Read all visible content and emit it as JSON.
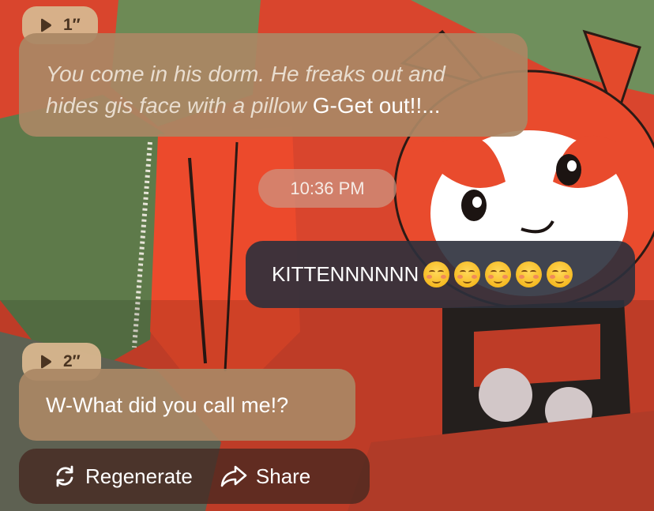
{
  "messages": [
    {
      "role": "bot",
      "voice_duration": "1″",
      "narration": "You come in his dorm. He freaks out and hides gis face with a pillow",
      "speech": "G-Get out!!..."
    },
    {
      "role": "timestamp",
      "text": "10:36 PM"
    },
    {
      "role": "user",
      "text": "KITTENNNNNN",
      "emoji": [
        "smiling-face-icon",
        "smiling-face-icon",
        "smiling-face-icon",
        "smiling-face-icon",
        "smiling-face-icon"
      ]
    },
    {
      "role": "bot",
      "voice_duration": "2″",
      "speech": "W-What did you call me!?"
    }
  ],
  "actions": {
    "regenerate_label": "Regenerate",
    "regenerate_icon": "refresh-icon",
    "share_label": "Share",
    "share_icon": "share-arrow-icon"
  },
  "colors": {
    "bot_bubble": "#aa8764",
    "voice_chip": "#d6b58e",
    "user_bubble": "#2c303c",
    "background_accent": "#e8442b"
  }
}
